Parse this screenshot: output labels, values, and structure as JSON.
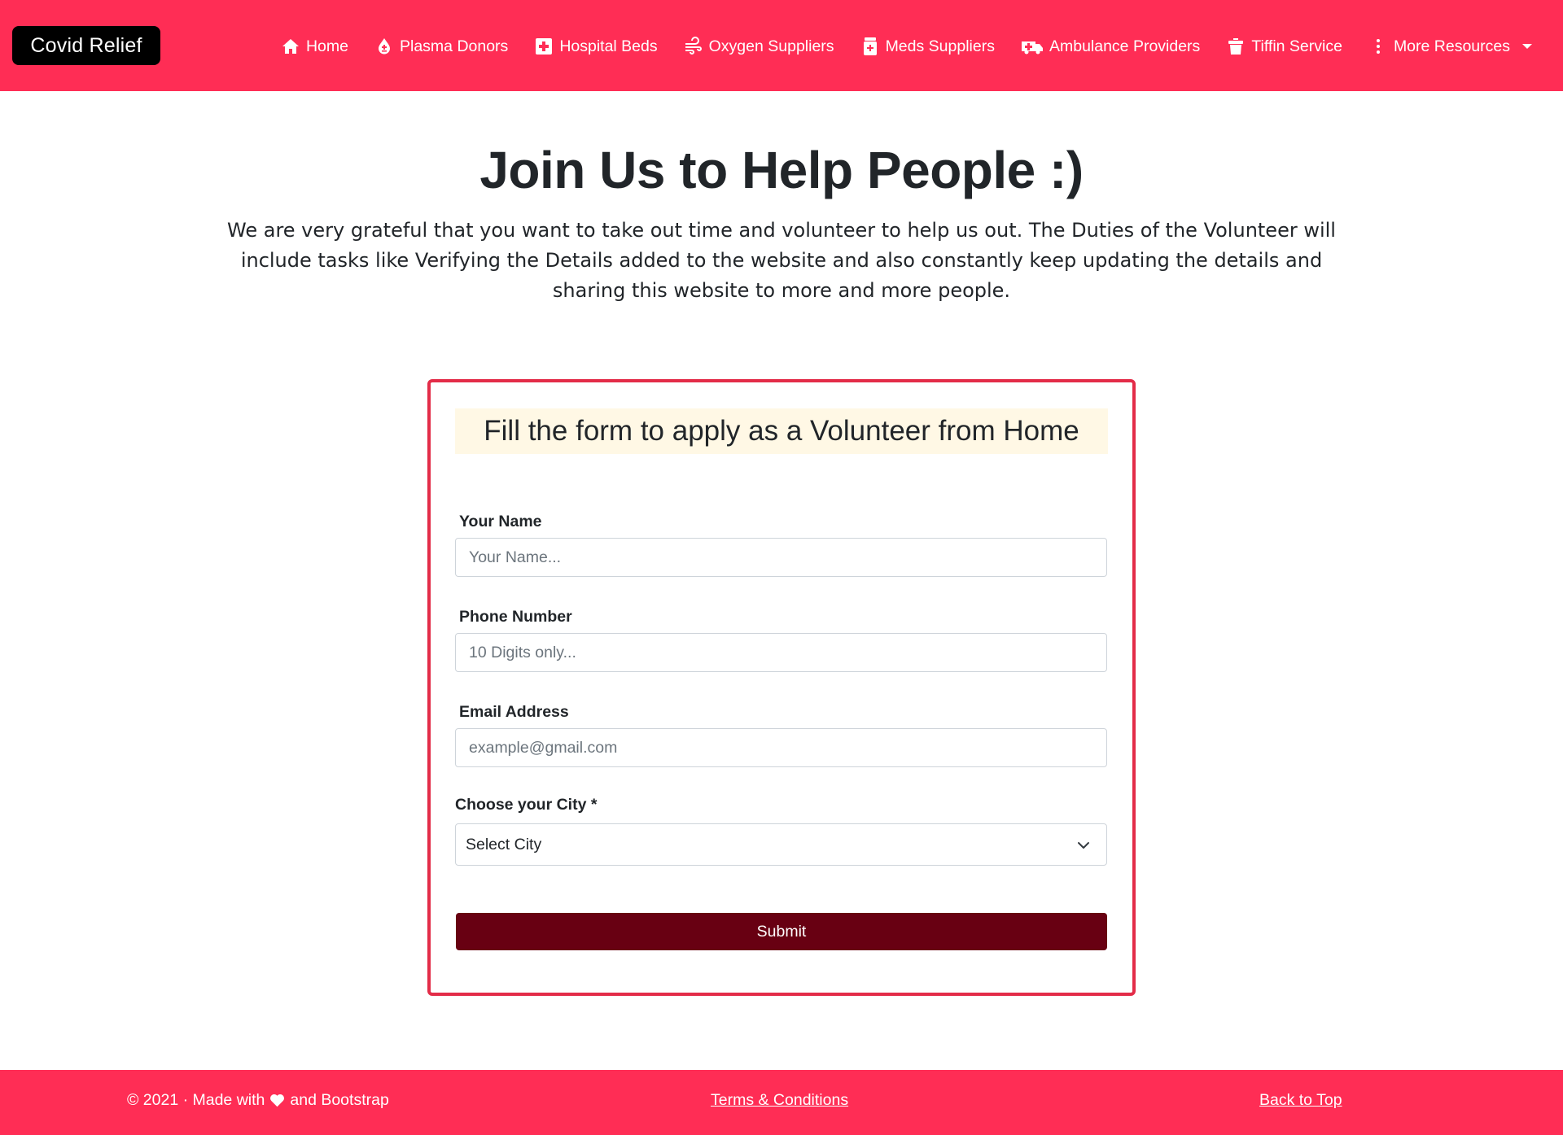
{
  "brand": "Covid Relief",
  "nav": {
    "items": [
      {
        "label": "Home",
        "icon": "home-icon"
      },
      {
        "label": "Plasma Donors",
        "icon": "blood-drop-icon"
      },
      {
        "label": "Hospital Beds",
        "icon": "medical-cross-icon"
      },
      {
        "label": "Oxygen Suppliers",
        "icon": "wind-icon"
      },
      {
        "label": "Meds Suppliers",
        "icon": "pill-bottle-icon"
      },
      {
        "label": "Ambulance Providers",
        "icon": "ambulance-icon"
      },
      {
        "label": "Tiffin Service",
        "icon": "tiffin-icon"
      },
      {
        "label": "More Resources",
        "icon": "kebab-icon"
      }
    ]
  },
  "hero": {
    "title": "Join Us to Help People :)",
    "description": "We are very grateful that you want to take out time and volunteer to help us out. The Duties of the Volunteer will include tasks like Verifying the Details added to the website and also constantly keep updating the details and sharing this website to more and more people."
  },
  "form": {
    "heading": "Fill the form to apply as a Volunteer from Home",
    "name": {
      "label": "Your Name",
      "placeholder": "Your Name...",
      "value": ""
    },
    "phone": {
      "label": "Phone Number",
      "placeholder": "10 Digits only...",
      "value": ""
    },
    "email": {
      "label": "Email Address",
      "placeholder": "example@gmail.com",
      "value": ""
    },
    "city": {
      "label": "Choose your City *",
      "selected": "Select City"
    },
    "submit_label": "Submit"
  },
  "footer": {
    "copy_prefix": "© 2021 · Made with",
    "copy_suffix": "and Bootstrap",
    "terms": "Terms & Conditions",
    "back_to_top": "Back to Top"
  },
  "colors": {
    "primary": "#ff2d55",
    "card_border": "#e32c48",
    "submit": "#680012",
    "heading_bg": "#fff8e5"
  }
}
